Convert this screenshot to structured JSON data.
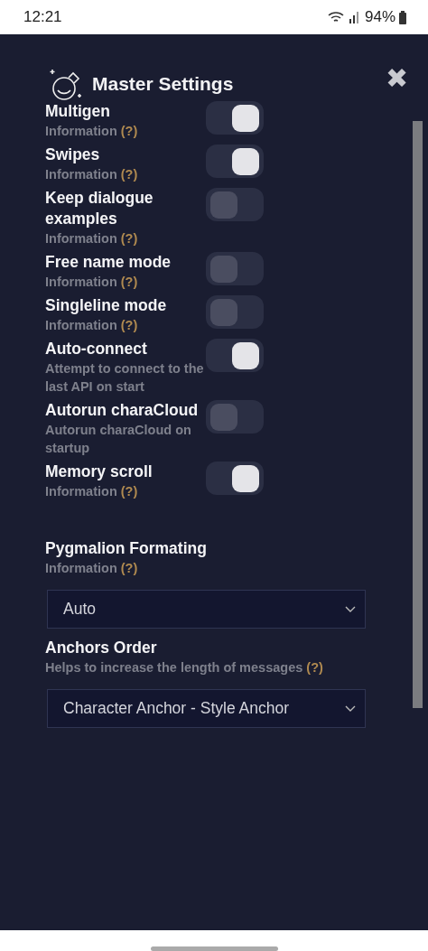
{
  "status_bar": {
    "time": "12:21",
    "battery": "94%"
  },
  "dialog": {
    "title": "Master Settings",
    "close": "✖"
  },
  "toggles": [
    {
      "label": "Multigen",
      "info": "Information",
      "help": "(?)",
      "on": true
    },
    {
      "label": "Swipes",
      "info": "Information",
      "help": "(?)",
      "on": true
    },
    {
      "label": "Keep dialogue examples",
      "info": "Information",
      "help": "(?)",
      "on": false
    },
    {
      "label": "Free name mode",
      "info": "Information",
      "help": "(?)",
      "on": false
    },
    {
      "label": "Singleline mode",
      "info": "Information",
      "help": "(?)",
      "on": false
    },
    {
      "label": "Auto-connect",
      "info": "Attempt to connect to the last API on start",
      "on": true
    },
    {
      "label": "Autorun charaCloud",
      "info": "Autorun charaCloud on startup",
      "on": false
    },
    {
      "label": "Memory scroll",
      "info": "Information",
      "help": "(?)",
      "on": true
    }
  ],
  "selects": [
    {
      "label": "Pygmalion Formating",
      "info": "Information",
      "help": "(?)",
      "value": "Auto"
    },
    {
      "label": "Anchors Order",
      "info": "Helps to increase the length of messages",
      "help": "(?)",
      "value": "Character Anchor - Style Anchor"
    }
  ]
}
